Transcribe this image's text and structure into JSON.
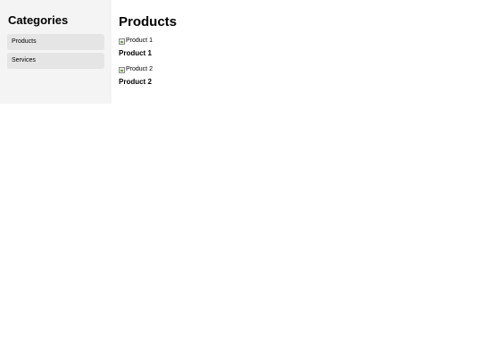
{
  "sidebar": {
    "title": "Categories",
    "items": [
      {
        "label": "Products"
      },
      {
        "label": "Services"
      }
    ]
  },
  "main": {
    "title": "Products",
    "products": [
      {
        "image_alt": "Product 1",
        "name": "Product 1"
      },
      {
        "image_alt": "Product 2",
        "name": "Product 2"
      }
    ]
  },
  "colors": {
    "sidebar_background": "#f4f4f4",
    "sidebar_item_background": "#e5e5e5",
    "page_background": "#ffffff"
  }
}
